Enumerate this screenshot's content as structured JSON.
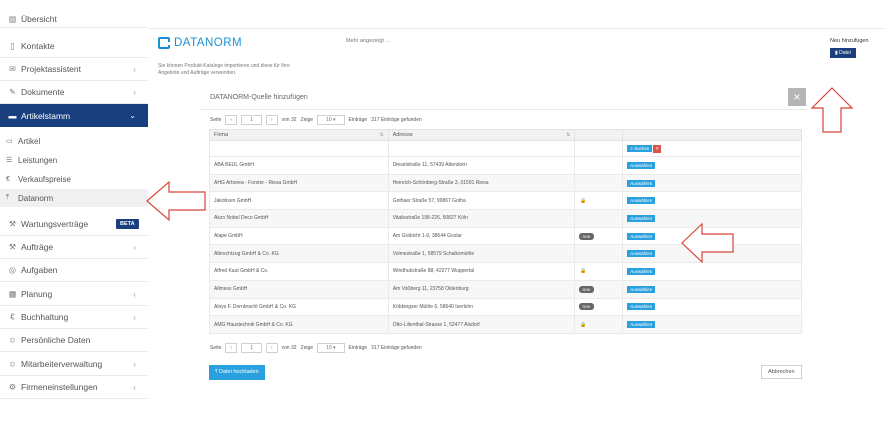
{
  "sidebar": {
    "items": [
      {
        "label": "Übersicht",
        "icon": "chart-icon"
      },
      {
        "label": "Kontakte",
        "icon": "contacts-icon"
      },
      {
        "label": "Projektassistent",
        "icon": "mail-icon",
        "chevron": "‹"
      },
      {
        "label": "Dokumente",
        "icon": "edit-icon",
        "chevron": "‹"
      },
      {
        "label": "Artikelstamm",
        "icon": "list-icon",
        "chevron": "⌄"
      },
      {
        "label": "Wartungsverträge",
        "icon": "wrench-icon",
        "badge": "BETA"
      },
      {
        "label": "Aufträge",
        "icon": "wrench-icon",
        "chevron": "‹"
      },
      {
        "label": "Aufgaben",
        "icon": "check-circle-icon"
      },
      {
        "label": "Planung",
        "icon": "calendar-icon",
        "chevron": "‹"
      },
      {
        "label": "Buchhaltung",
        "icon": "euro-icon",
        "chevron": "‹"
      },
      {
        "label": "Persönliche Daten",
        "icon": "user-icon"
      },
      {
        "label": "Mitarbeiterverwaltung",
        "icon": "users-icon",
        "chevron": "‹"
      },
      {
        "label": "Firmeneinstellungen",
        "icon": "gear-icon",
        "chevron": "‹"
      }
    ],
    "subitems": [
      {
        "label": "Artikel",
        "icon": "list-icon"
      },
      {
        "label": "Leistungen",
        "icon": "list-icon"
      },
      {
        "label": "Verkaufspreise",
        "icon": "euro-icon"
      },
      {
        "label": "Datanorm",
        "icon": "upload-icon"
      }
    ]
  },
  "top": {
    "logo": "DATANORM",
    "note": "Mehr angezeigt …",
    "desc": "Sie können Produkt-Kataloge importieren und diese für Ihre Angebote und Aufträge verwenden.",
    "new_label": "Neu hinzufügen",
    "file_button": "Datei"
  },
  "modal": {
    "title": "DATANORM-Quelle hinzufügen",
    "close": "×",
    "pager": {
      "seite": "Seite",
      "prev": "‹",
      "page": "1",
      "next": "›",
      "of": "von 32",
      "zeige": "Zeige",
      "size": "10",
      "entries": "Einträge",
      "found": "317 Einträge gefunden"
    },
    "columns": [
      "Firma",
      "Adresse"
    ],
    "search_button": "Suchen",
    "clear_button": "✕",
    "select_label": "Auswählen",
    "rows": [
      {
        "firma": "ABA BEUL GmbH",
        "adresse": "Dieselstraße 11, 57439 Attendorn",
        "status": ""
      },
      {
        "firma": "AHG Arborea - Forster - Riesa GmbH",
        "adresse": "Heinrich-Schönberg-Straße 3, 01591 Riesa",
        "status": ""
      },
      {
        "firma": "Jakobsen GmbH",
        "adresse": "Gothaer Straße 57, 99867 Gotha",
        "status": "lock"
      },
      {
        "firma": "Akzo Nobel Deco GmbH",
        "adresse": "Vitalisstraße 198-226, 50827 Köln",
        "status": ""
      },
      {
        "firma": "Alape GmbH",
        "adresse": "Am Gräbicht 1-9, 38644 Goslar",
        "status": "SHK"
      },
      {
        "firma": "Albrechtzug GmbH & Co. KG",
        "adresse": "Volmestraße 1, 58579 Schalksmühle",
        "status": ""
      },
      {
        "firma": "Alfred Kaut GmbH & Co.",
        "adresse": "Windhukstraße 88, 42277 Wuppertal",
        "status": "lock"
      },
      {
        "firma": "Allmess GmbH",
        "adresse": "Am Voßberg 11, 23758 Oldenburg",
        "status": "SHK"
      },
      {
        "firma": "Aloys F. Dornbracht GmbH & Co. KG",
        "adresse": "Köbbingser Mühle 6, 58640 Iserlohn",
        "status": "SHK"
      },
      {
        "firma": "AMG Haustechnik GmbH & Co. KG",
        "adresse": "Otto-Lilienthal-Strasse 1, 52477 Alsdorf",
        "status": "lock"
      }
    ],
    "upload_button": "Datei hochladen",
    "cancel_button": "Abbrechen"
  },
  "colors": {
    "primary": "#1a3f7e",
    "accent": "#2aa1de",
    "arrow": "#d9443a"
  }
}
